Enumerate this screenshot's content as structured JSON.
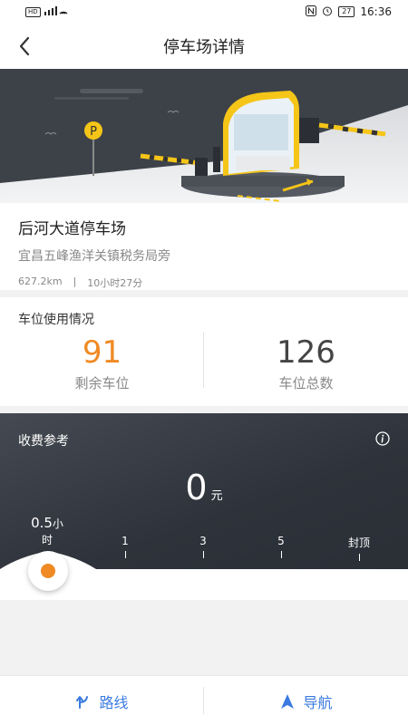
{
  "status_bar": {
    "left_indicators": "HD 46 ⁴ᴳ ıl",
    "time": "16:36",
    "battery": "27"
  },
  "nav": {
    "title": "停车场详情",
    "back_icon": "chevron-left-icon"
  },
  "hero": {
    "parking_sign": "P"
  },
  "lot": {
    "name": "后河大道停车场",
    "address": "宜昌五峰渔洋关镇税务局旁",
    "distance": "627.2km",
    "separator": "|",
    "duration": "10小时27分"
  },
  "spaces": {
    "title": "车位使用情况",
    "available_value": "91",
    "available_label": "剩余车位",
    "total_value": "126",
    "total_label": "车位总数"
  },
  "fee": {
    "title": "收费参考",
    "amount": "0",
    "unit": "元",
    "ticks": [
      {
        "label": "0.5",
        "sub": "小时"
      },
      {
        "label": "1"
      },
      {
        "label": "3"
      },
      {
        "label": "5"
      },
      {
        "label": "封顶"
      }
    ],
    "slider_position": 0
  },
  "bottom": {
    "route_label": "路线",
    "navigate_label": "导航"
  },
  "colors": {
    "accent_orange": "#f08a24",
    "accent_blue": "#3b7be0",
    "dark_panel": "#2e333b"
  }
}
